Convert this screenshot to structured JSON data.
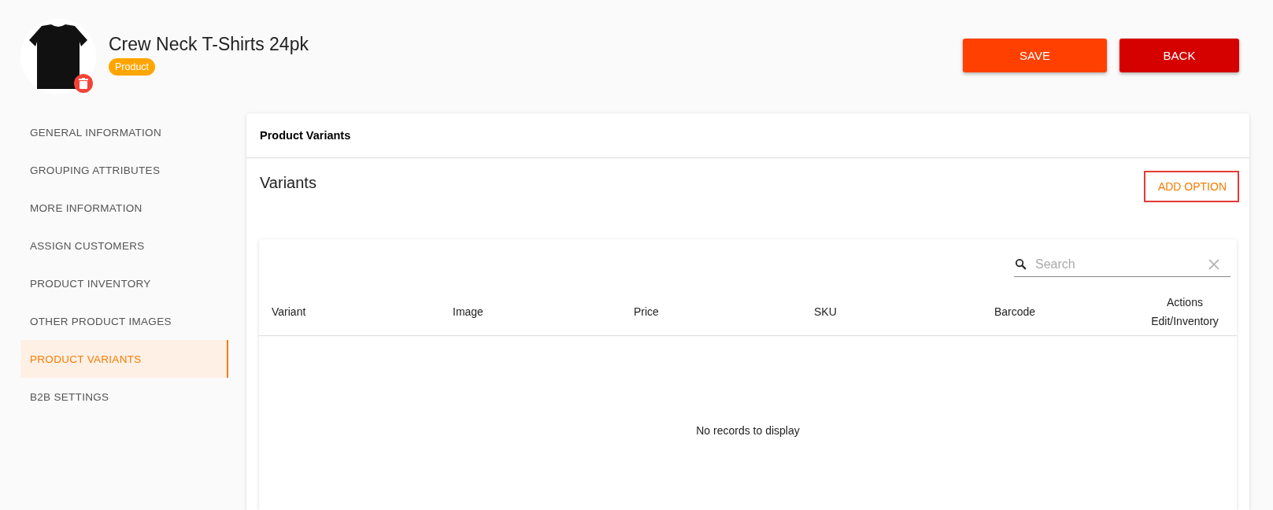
{
  "product": {
    "title": "Crew Neck T-Shirts 24pk",
    "badge": "Product"
  },
  "buttons": [
    {
      "label": "SAVE",
      "kind": "primary"
    },
    {
      "label": "BACK",
      "kind": "danger"
    }
  ],
  "sidebar": {
    "items": [
      {
        "label": "GENERAL INFORMATION",
        "selected": false
      },
      {
        "label": "GROUPING ATTRIBUTES",
        "selected": false
      },
      {
        "label": "MORE INFORMATION",
        "selected": false
      },
      {
        "label": "ASSIGN CUSTOMERS",
        "selected": false
      },
      {
        "label": "PRODUCT INVENTORY",
        "selected": false
      },
      {
        "label": "OTHER PRODUCT IMAGES",
        "selected": false
      },
      {
        "label": "PRODUCT VARIANTS",
        "selected": true
      },
      {
        "label": "B2B SETTINGS",
        "selected": false
      }
    ]
  },
  "panel": {
    "title": "Product Variants",
    "section_title": "Variants",
    "add_button": "ADD OPTION",
    "table": {
      "search": {
        "placeholder": "Search"
      },
      "columns": [
        {
          "label": "Variant"
        },
        {
          "label": "Image"
        },
        {
          "label": "Price"
        },
        {
          "label": "SKU"
        },
        {
          "label": "Barcode"
        },
        {
          "label": "Actions",
          "sublabel": "Edit/Inventory"
        }
      ],
      "empty_message": "No records to display"
    }
  }
}
